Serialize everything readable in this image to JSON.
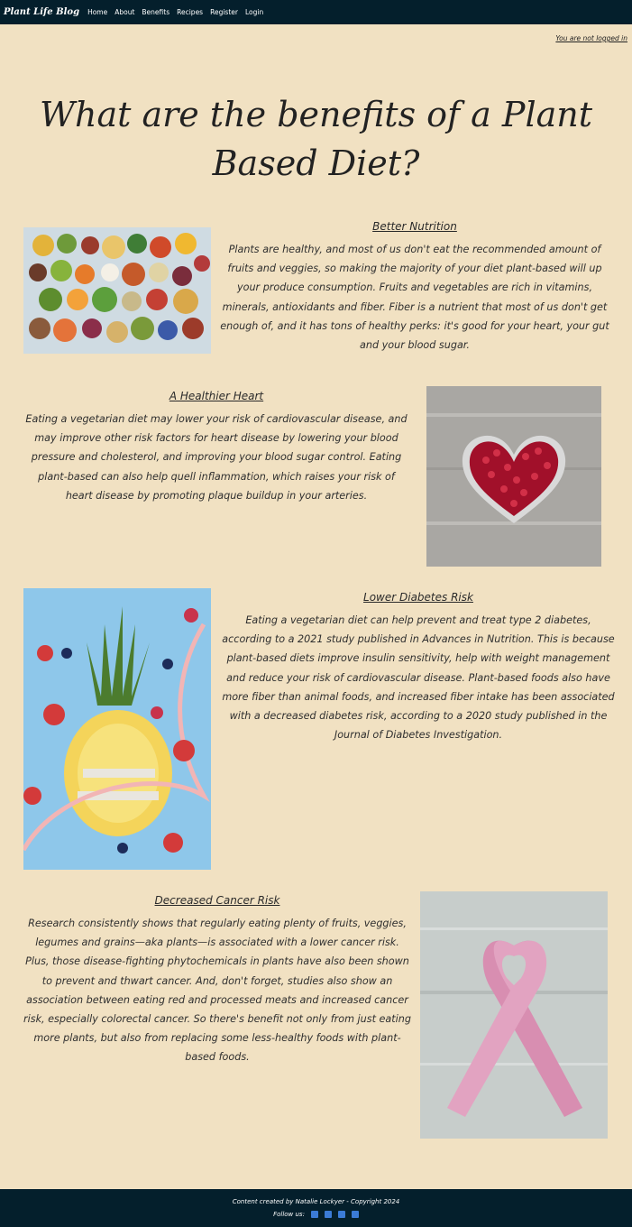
{
  "nav": {
    "brand": "Plant Life Blog",
    "links": [
      "Home",
      "About",
      "Benefits",
      "Recipes",
      "Register",
      "Login"
    ]
  },
  "status": "You are not logged in",
  "title": "What are the benefits of a Plant Based Diet?",
  "sections": [
    {
      "heading": "Better Nutrition",
      "text": "Plants are healthy, and most of us don't eat the recommended amount of fruits and veggies, so making the majority of your diet plant-based will up your produce consumption. Fruits and vegetables are rich in vitamins, minerals, antioxidants and fiber. Fiber is a nutrient that most of us don't get enough of, and it has tons of healthy perks: it's good for your heart, your gut and your blood sugar."
    },
    {
      "heading": "A Healthier Heart",
      "text": "Eating a vegetarian diet may lower your risk of cardiovascular disease, and may improve other risk factors for heart disease by lowering your blood pressure and cholesterol, and improving your blood sugar control. Eating plant-based can also help quell inflammation, which raises your risk of heart disease by promoting plaque buildup in your arteries."
    },
    {
      "heading": "Lower Diabetes Risk",
      "text": "Eating a vegetarian diet can help prevent and treat type 2 diabetes, according to a 2021 study published in Advances in Nutrition. This is because plant-based diets improve insulin sensitivity, help with weight management and reduce your risk of cardiovascular disease. Plant-based foods also have more fiber than animal foods, and increased fiber intake has been associated with a decreased diabetes risk, according to a 2020 study published in the Journal of Diabetes Investigation."
    },
    {
      "heading": "Decreased Cancer Risk",
      "text": "Research consistently shows that regularly eating plenty of fruits, veggies, legumes and grains—aka plants—is associated with a lower cancer risk. Plus, those disease-fighting phytochemicals in plants have also been shown to prevent and thwart cancer. And, don't forget, studies also show an association between eating red and processed meats and increased cancer risk, especially colorectal cancer. So there's benefit not only from just eating more plants, but also from replacing some less-healthy foods with plant-based foods."
    }
  ],
  "footer": {
    "credit": "Content created by Natalie Lockyer - Copyright 2024",
    "follow": "Follow us:",
    "social_icons": [
      "facebook-icon",
      "twitter-icon",
      "x-icon",
      "instagram-icon"
    ]
  }
}
